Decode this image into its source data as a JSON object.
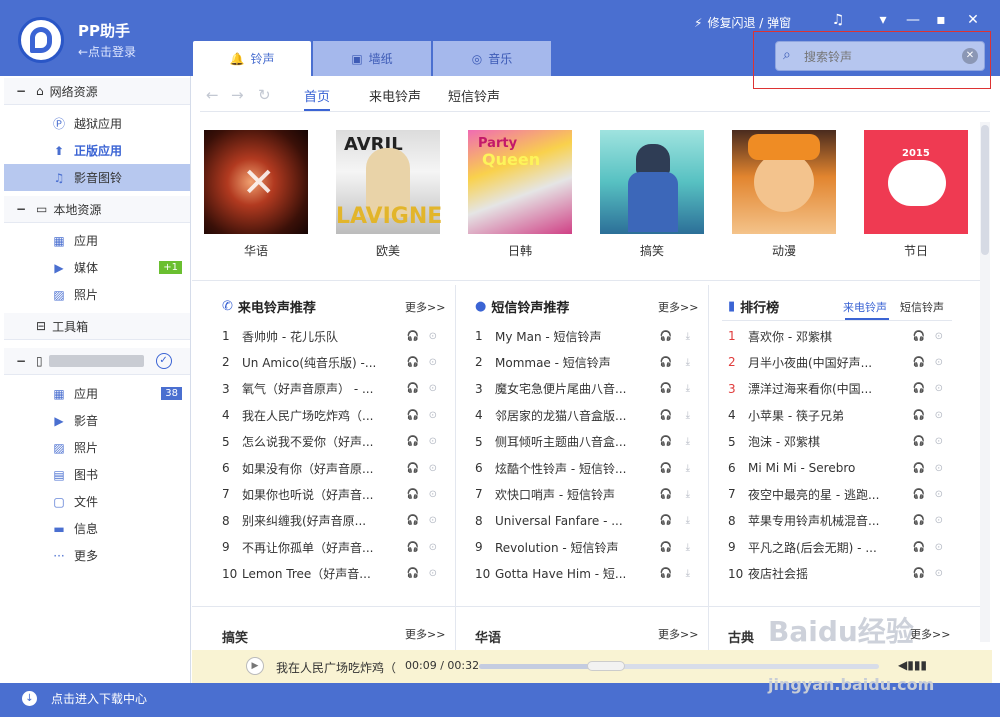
{
  "app": {
    "name": "PP助手",
    "login": "←点击登录"
  },
  "titlebar": {
    "repair_label": "修复闪退 / 弹窗"
  },
  "tabs": [
    {
      "label": "铃声"
    },
    {
      "label": "墙纸"
    },
    {
      "label": "音乐"
    }
  ],
  "search": {
    "placeholder": "搜索铃声"
  },
  "sidebar": {
    "network": {
      "label": "网络资源"
    },
    "network_items": [
      {
        "label": "越狱应用"
      },
      {
        "label": "正版应用"
      },
      {
        "label": "影音图铃"
      }
    ],
    "local": {
      "label": "本地资源"
    },
    "local_items": [
      {
        "label": "应用"
      },
      {
        "label": "媒体",
        "badge": "+1"
      },
      {
        "label": "照片"
      }
    ],
    "toolbox": {
      "label": "工具箱"
    },
    "device_items": [
      {
        "label": "应用",
        "badge": "38"
      },
      {
        "label": "影音"
      },
      {
        "label": "照片"
      },
      {
        "label": "图书"
      },
      {
        "label": "文件"
      },
      {
        "label": "信息"
      },
      {
        "label": "更多"
      }
    ],
    "download_center": "点击进入下载中心"
  },
  "subnav": {
    "tabs": [
      "首页",
      "来电铃声",
      "短信铃声"
    ]
  },
  "albums": [
    {
      "label": "华语"
    },
    {
      "label": "欧美"
    },
    {
      "label": "日韩"
    },
    {
      "label": "搞笑"
    },
    {
      "label": "动漫"
    },
    {
      "label": "节日"
    }
  ],
  "columns": [
    {
      "title": "来电铃声推荐",
      "more": "更多>>",
      "rows": [
        {
          "n": "1",
          "t": "香帅帅 - 花儿乐队"
        },
        {
          "n": "2",
          "t": "Un Amico(纯音乐版) -..."
        },
        {
          "n": "3",
          "t": "氧气（好声音原声） - ..."
        },
        {
          "n": "4",
          "t": "我在人民广场吃炸鸡（..."
        },
        {
          "n": "5",
          "t": "怎么说我不爱你（好声..."
        },
        {
          "n": "6",
          "t": "如果没有你（好声音原..."
        },
        {
          "n": "7",
          "t": "如果你也听说（好声音..."
        },
        {
          "n": "8",
          "t": "别来纠缠我(好声音原..."
        },
        {
          "n": "9",
          "t": "不再让你孤单（好声音..."
        },
        {
          "n": "10",
          "t": "Lemon Tree（好声音..."
        }
      ]
    },
    {
      "title": "短信铃声推荐",
      "more": "更多>>",
      "rows": [
        {
          "n": "1",
          "t": "My Man - 短信铃声"
        },
        {
          "n": "2",
          "t": "Mommae - 短信铃声"
        },
        {
          "n": "3",
          "t": "魔女宅急便片尾曲八音..."
        },
        {
          "n": "4",
          "t": "邻居家的龙猫八音盒版..."
        },
        {
          "n": "5",
          "t": "侧耳倾听主题曲八音盒..."
        },
        {
          "n": "6",
          "t": "炫酷个性铃声 - 短信铃..."
        },
        {
          "n": "7",
          "t": "欢快口哨声 - 短信铃声"
        },
        {
          "n": "8",
          "t": "Universal Fanfare - ..."
        },
        {
          "n": "9",
          "t": "Revolution - 短信铃声"
        },
        {
          "n": "10",
          "t": "Gotta Have Him - 短..."
        }
      ]
    },
    {
      "title": "排行榜",
      "tab1": "来电铃声",
      "tab2": "短信铃声",
      "rows": [
        {
          "n": "1",
          "t": "喜欢你 - 邓紫棋"
        },
        {
          "n": "2",
          "t": "月半小夜曲(中国好声..."
        },
        {
          "n": "3",
          "t": "漂洋过海来看你(中国..."
        },
        {
          "n": "4",
          "t": "小苹果 - 筷子兄弟"
        },
        {
          "n": "5",
          "t": "泡沫 - 邓紫棋"
        },
        {
          "n": "6",
          "t": "Mi Mi Mi - Serebro"
        },
        {
          "n": "7",
          "t": "夜空中最亮的星 - 逃跑..."
        },
        {
          "n": "8",
          "t": "苹果专用铃声机械混音..."
        },
        {
          "n": "9",
          "t": "平凡之路(后会无期) - ..."
        },
        {
          "n": "10",
          "t": "夜店社会摇"
        }
      ]
    }
  ],
  "bottom_sections": [
    {
      "title": "搞笑",
      "more": "更多>>"
    },
    {
      "title": "华语",
      "more": "更多>>"
    },
    {
      "title": "古典",
      "more": "更多>>"
    }
  ],
  "player": {
    "track": "我在人民广场吃炸鸡（",
    "time": "00:09 / 00:32",
    "progress": 0.28
  },
  "watermark": {
    "line1": "Baidu经验",
    "line2": "jingyan.baidu.com"
  },
  "colors": {
    "accent": "#4a6fd0",
    "rank_red": "#e03c3c",
    "badge_green": "#6abf30",
    "badge_blue": "#4a6fd0"
  }
}
